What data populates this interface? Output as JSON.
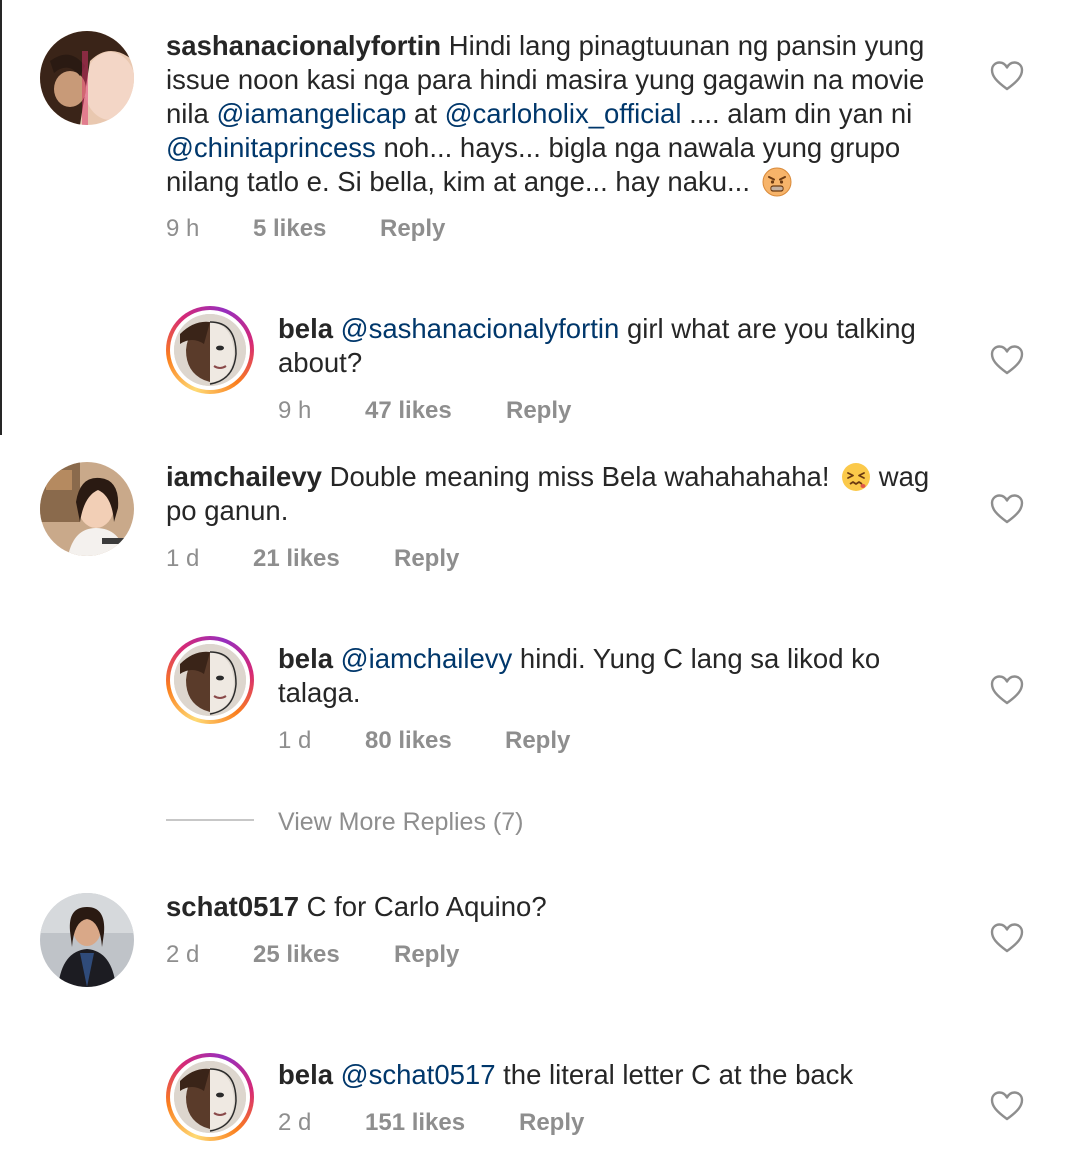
{
  "comments": [
    {
      "username": "sashanacionalyfortin",
      "body": [
        {
          "t": "Hindi lang pinagtuunan ng pansin yung issue noon kasi nga para hindi masira yung gagawin na movie nila "
        },
        {
          "t": "@iamangelicap",
          "mention": true
        },
        {
          "t": " at "
        },
        {
          "t": "@carloholix_official",
          "mention": true
        },
        {
          "t": " .... alam din yan ni "
        },
        {
          "t": "@chinitaprincess",
          "mention": true
        },
        {
          "t": " noh... hays... bigla nga nawala yung grupo nilang tatlo e. Si bella, kim at ange... hay naku... "
        }
      ],
      "emoji": "angry-face-emoji",
      "time": "9 h",
      "likes": "5 likes",
      "reply": "Reply"
    },
    {
      "username": "bela",
      "body": [
        {
          "t": "@sashanacionalyfortin",
          "mention": true
        },
        {
          "t": " girl what are you talking about?"
        }
      ],
      "time": "9 h",
      "likes": "47 likes",
      "reply": "Reply"
    },
    {
      "username": "iamchailevy",
      "body": [
        {
          "t": "Double meaning miss Bela wahahahaha! "
        }
      ],
      "emoji": "confounded-face-emoji",
      "body_after": " wag po ganun.",
      "time": "1 d",
      "likes": "21 likes",
      "reply": "Reply"
    },
    {
      "username": "bela",
      "body": [
        {
          "t": "@iamchailevy",
          "mention": true
        },
        {
          "t": " hindi. Yung C lang sa likod ko talaga."
        }
      ],
      "time": "1 d",
      "likes": "80 likes",
      "reply": "Reply"
    },
    {
      "username": "schat0517",
      "body": [
        {
          "t": "C for Carlo Aquino?"
        }
      ],
      "time": "2 d",
      "likes": "25 likes",
      "reply": "Reply"
    },
    {
      "username": "bela",
      "body": [
        {
          "t": "@schat0517",
          "mention": true
        },
        {
          "t": " the literal letter C at the back"
        }
      ],
      "time": "2 d",
      "likes": "151 likes",
      "reply": "Reply"
    }
  ],
  "view_more_replies": "View More Replies (7)",
  "colors": {
    "mention": "#00376b",
    "meta": "#8e8e8e",
    "text": "#262626"
  },
  "icons": {
    "like": "heart-outline-icon"
  }
}
